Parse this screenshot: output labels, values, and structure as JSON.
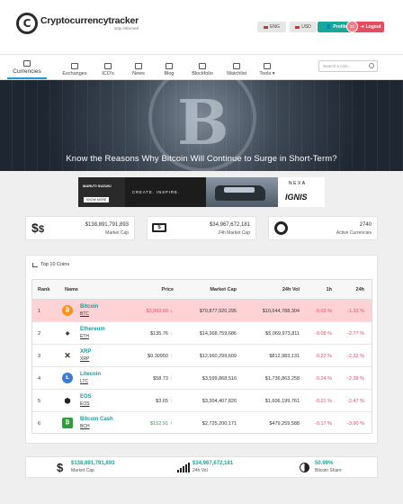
{
  "header": {
    "logo_name": "Cryptocurrencytracker",
    "logo_tagline": "stay informed",
    "lang_label": "ENG",
    "currency_label": "USD",
    "profile_label": "Profile",
    "logout_label": "Logout",
    "notification_count": "22"
  },
  "nav": {
    "items": [
      {
        "label": "Currencies",
        "icon": "currencies-icon"
      },
      {
        "label": "Exchanges",
        "icon": "exchanges-icon"
      },
      {
        "label": "ICO's",
        "icon": "ico-icon"
      },
      {
        "label": "News",
        "icon": "news-icon"
      },
      {
        "label": "Blog",
        "icon": "blog-icon"
      },
      {
        "label": "Blockfolio",
        "icon": "blockfolio-icon"
      },
      {
        "label": "Watchlist",
        "icon": "watchlist-icon"
      },
      {
        "label": "Tools ▾",
        "icon": "tools-icon"
      }
    ],
    "search_placeholder": "Search a coin..."
  },
  "hero": {
    "headline": "Know the Reasons Why Bitcoin Will Continue to Surge in Short-Term?"
  },
  "ad": {
    "brand": "MARUTI SUZUKI",
    "cta": "KNOW MORE",
    "tagline": "CREATE. INSPIRE.",
    "nexa": "NEXA",
    "model": "IGNIS"
  },
  "stats": {
    "market_cap_value": "$138,891,791,893",
    "market_cap_label": "Market Cap",
    "vol_value": "$34,967,672,181",
    "vol_label": "24h Market Cap",
    "active_value": "2740",
    "active_label": "Active Currencies"
  },
  "top10": {
    "title": "Top 10 Coins",
    "columns": {
      "rank": "Rank",
      "name": "Name",
      "price": "Price",
      "mcap": "Market Cap",
      "vol": "24h Vol",
      "h1": "1h",
      "h24": "24h"
    },
    "rows": [
      {
        "rank": "1",
        "name": "Bitcoin",
        "symbol": "BTC",
        "price": "$3,993.60",
        "mcap": "$70,877,920,295",
        "vol": "$10,644,788,304",
        "h1": "-0.03 %",
        "h24": "-1.33 %",
        "color": "#f7931a",
        "glyph": "₿"
      },
      {
        "rank": "2",
        "name": "Ethereum",
        "symbol": "ETH",
        "price": "$135.76",
        "mcap": "$14,368,759,686",
        "vol": "$5,069,973,811",
        "h1": "-0.08 %",
        "h24": "-2.77 %",
        "color": "#555555",
        "glyph": "◆"
      },
      {
        "rank": "3",
        "name": "XRP",
        "symbol": "XRP",
        "price": "$0.30950",
        "mcap": "$12,960,299,609",
        "vol": "$812,983,131",
        "h1": "-0.22 %",
        "h24": "-2.32 %",
        "color": "#ffffff",
        "glyph": "✕"
      },
      {
        "rank": "4",
        "name": "Litecoin",
        "symbol": "LTC",
        "price": "$58.73",
        "mcap": "$3,599,868,516",
        "vol": "$1,736,863,258",
        "h1": "-0.24 %",
        "h24": "-2.38 %",
        "color": "#3a7bd5",
        "glyph": "Ł"
      },
      {
        "rank": "5",
        "name": "EOS",
        "symbol": "EOS",
        "price": "$3.65",
        "mcap": "$3,304,407,826",
        "vol": "$1,606,199,761",
        "h1": "-0.21 %",
        "h24": "-2.47 %",
        "color": "#ffffff",
        "glyph": "⬢"
      },
      {
        "rank": "6",
        "name": "Bitcoin Cash",
        "symbol": "BCH",
        "price": "$152.91",
        "mcap": "$2,725,200,171",
        "vol": "$479,259,588",
        "h1": "-0.17 %",
        "h24": "-3.90 %",
        "color": "#2e9d3a",
        "glyph": "₿"
      }
    ]
  },
  "bottom": {
    "mcap_value": "$138,891,791,893",
    "mcap_label": "Market Cap",
    "vol_value": "$34,967,672,181",
    "vol_label": "24h Vol",
    "share_value": "50.99%",
    "share_label": "Bitcoin Share"
  },
  "colors": {
    "accent": "#17a89b",
    "negative": "#e84a5f",
    "positive": "#2e9d3a",
    "highlight_row": "#ffd3d6"
  }
}
